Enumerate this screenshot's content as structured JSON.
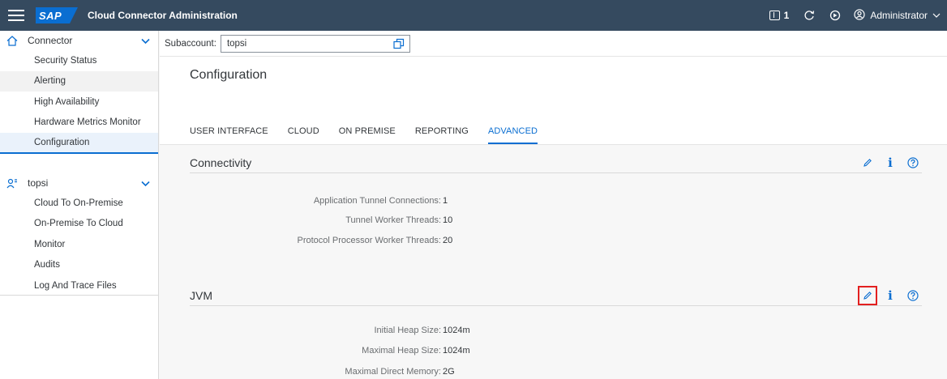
{
  "shell": {
    "logo_text": "SAP",
    "title": "Cloud Connector Administration",
    "notification_count": "1",
    "user_label": "Administrator"
  },
  "sidebar": {
    "connector_group": {
      "label": "Connector",
      "items": [
        {
          "label": "Security Status"
        },
        {
          "label": "Alerting"
        },
        {
          "label": "High Availability"
        },
        {
          "label": "Hardware Metrics Monitor"
        },
        {
          "label": "Configuration"
        }
      ]
    },
    "subaccount_group": {
      "label": "topsi",
      "items": [
        {
          "label": "Cloud To On-Premise"
        },
        {
          "label": "On-Premise To Cloud"
        },
        {
          "label": "Monitor"
        },
        {
          "label": "Audits"
        },
        {
          "label": "Log And Trace Files"
        }
      ]
    }
  },
  "subaccount_bar": {
    "label": "Subaccount:",
    "value": "topsi"
  },
  "page": {
    "title": "Configuration",
    "tabs": [
      {
        "label": "USER INTERFACE"
      },
      {
        "label": "CLOUD"
      },
      {
        "label": "ON PREMISE"
      },
      {
        "label": "REPORTING"
      },
      {
        "label": "ADVANCED",
        "active": true
      }
    ]
  },
  "connectivity": {
    "title": "Connectivity",
    "rows": [
      {
        "key": "Application Tunnel Connections:",
        "value": "1"
      },
      {
        "key": "Tunnel Worker Threads:",
        "value": "10"
      },
      {
        "key": "Protocol Processor Worker Threads:",
        "value": "20"
      }
    ]
  },
  "jvm": {
    "title": "JVM",
    "rows": [
      {
        "key": "Initial Heap Size:",
        "value": "1024m"
      },
      {
        "key": "Maximal Heap Size:",
        "value": "1024m"
      },
      {
        "key": "Maximal Direct Memory:",
        "value": "2G"
      }
    ]
  },
  "colors": {
    "shell_bg": "#354a5f",
    "accent": "#0a6ed1",
    "focus_outline": "#e32020"
  },
  "icons": [
    "menu-icon",
    "home-icon",
    "chevron-down-icon",
    "user-group-icon",
    "copy-icon",
    "edit-icon",
    "info-icon",
    "help-icon",
    "refresh-icon",
    "notification-icon",
    "user-icon"
  ]
}
